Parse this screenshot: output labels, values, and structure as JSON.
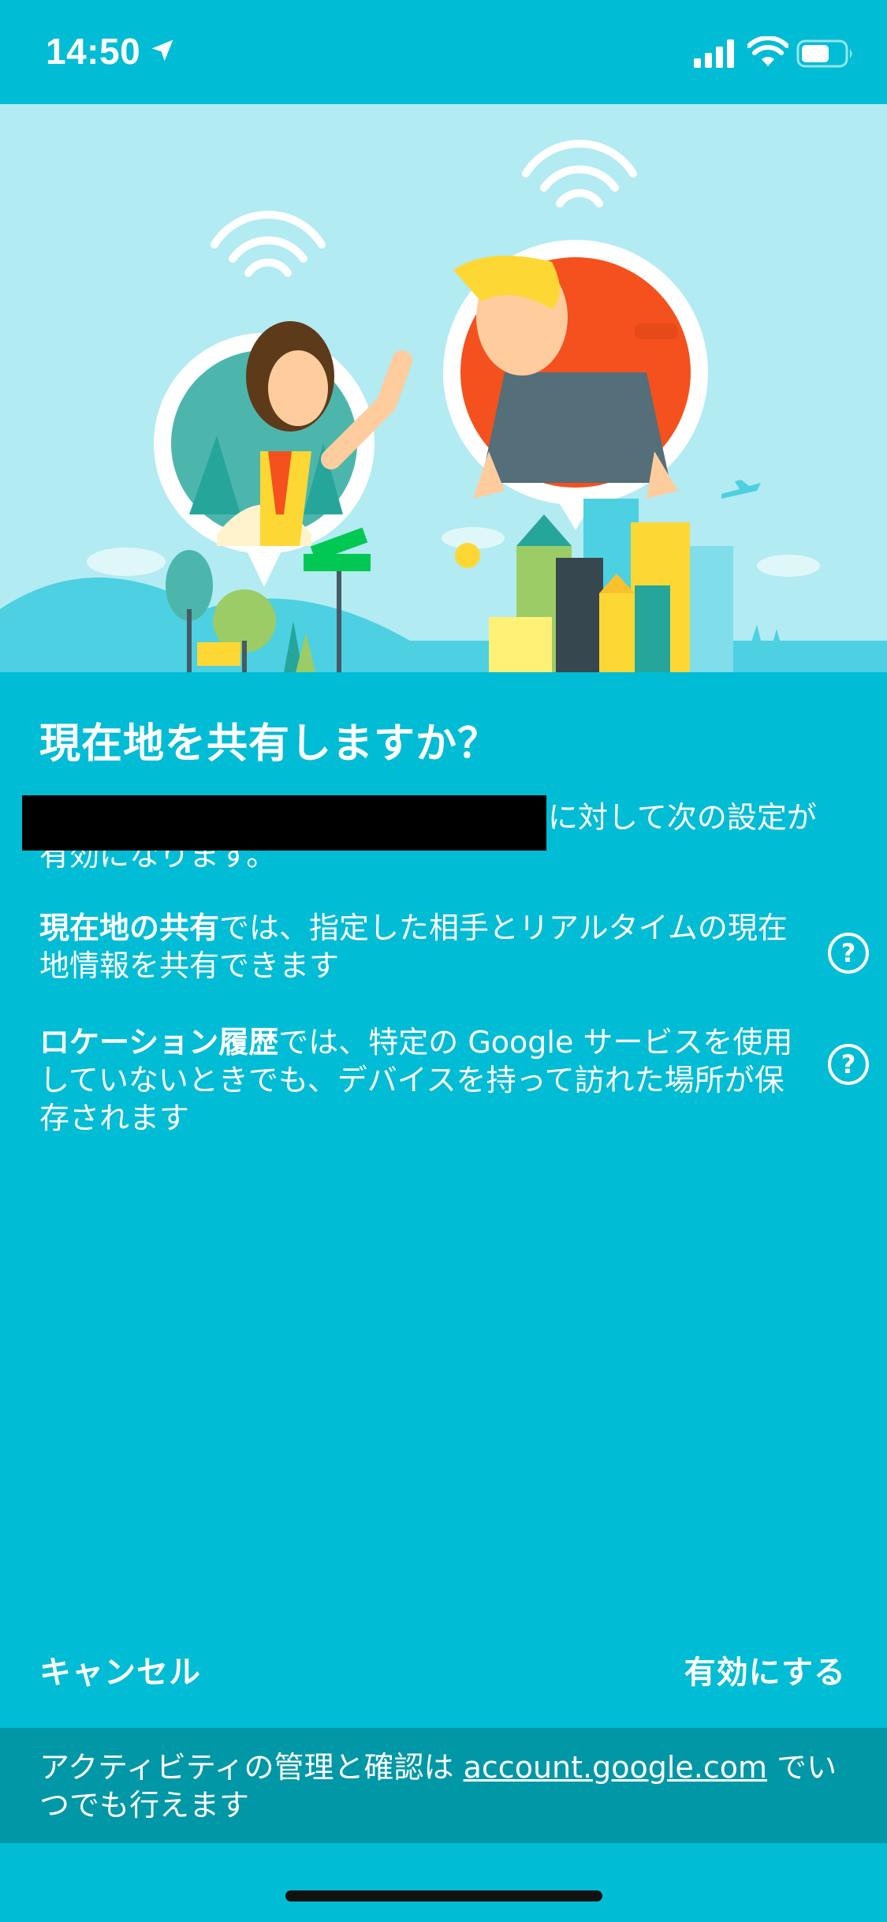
{
  "status_bar": {
    "time": "14:50",
    "icons": [
      "location-arrow-icon",
      "signal-icon",
      "wifi-icon",
      "battery-icon"
    ]
  },
  "illustration": {
    "description_icons": [
      "wifi-waves-icon",
      "person-woman-icon",
      "person-man-icon",
      "city-skyline-icon",
      "street-sign-icon",
      "airplane-icon"
    ],
    "colors": {
      "sky": "#b2ebf2",
      "accent_red": "#f4511e",
      "teal": "#4db6ac"
    }
  },
  "dialog": {
    "title": "現在地を共有しますか？",
    "intro_suffix": "に対して次の設定が",
    "intro_line2": "有効になります。",
    "items": [
      {
        "bold": "現在地の共有",
        "text": "では、指定した相手とリアルタイムの現在地情報を共有できます",
        "help_icon": "help-circle-icon"
      },
      {
        "bold": "ロケーション履歴",
        "text": "では、特定の Google サービスを使用していないときでも、デバイスを持って訪れた場所が保存されます",
        "help_icon": "help-circle-icon"
      }
    ],
    "cancel_label": "キャンセル",
    "enable_label": "有効にする"
  },
  "footer": {
    "text_before": "アクティビティの管理と確認は ",
    "link": "account.google.com",
    "text_after": " でいつでも行えます"
  },
  "colors": {
    "background": "#00bcd4",
    "footer_bg": "#0097a7",
    "text": "#ffffff"
  }
}
